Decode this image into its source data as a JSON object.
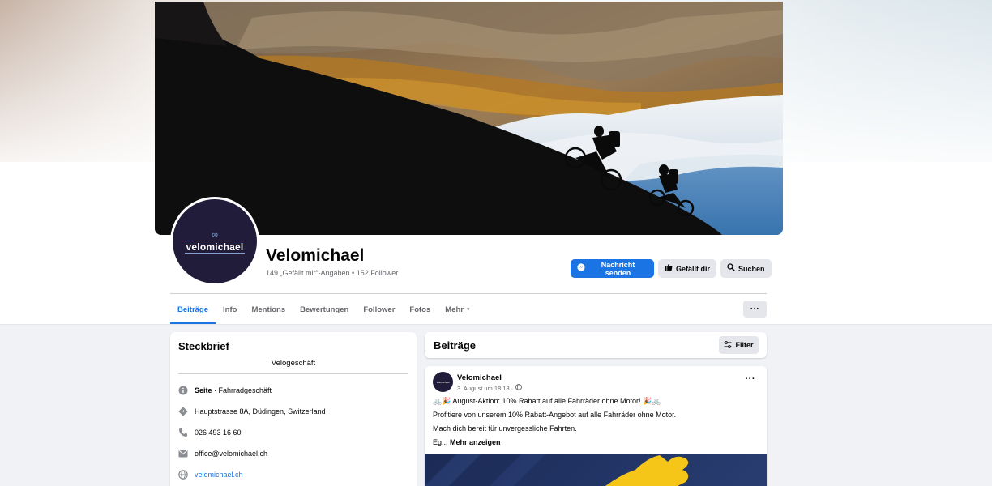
{
  "page": {
    "name": "Velomichael",
    "stats": "149 „Gefällt mir“-Angaben • 152 Follower",
    "avatar_text": "velomichael"
  },
  "actions": {
    "message": "Nachricht senden",
    "like": "Gefällt dir",
    "search": "Suchen",
    "more": "···"
  },
  "tabs": [
    {
      "label": "Beiträge",
      "active": true
    },
    {
      "label": "Info"
    },
    {
      "label": "Mentions"
    },
    {
      "label": "Bewertungen"
    },
    {
      "label": "Follower"
    },
    {
      "label": "Fotos"
    },
    {
      "label": "Mehr",
      "caret": "▾"
    }
  ],
  "intro": {
    "title": "Steckbrief",
    "category": "Velogeschäft",
    "page_type_bold": "Seite",
    "page_type_rest": " · Fahrradgeschäft",
    "address": "Hauptstrasse 8A, Düdingen, Switzerland",
    "phone": "026 493 16 60",
    "email": "office@velomichael.ch",
    "website": "velomichael.ch"
  },
  "posts": {
    "title": "Beiträge",
    "filter": "Filter"
  },
  "post": {
    "avatar_text": "velomichael",
    "author": "Velomichael",
    "date": "3. August um 18:18 ·",
    "line1": "🚲🎉 August-Aktion: 10% Rabatt auf alle Fahrräder ohne Motor! 🎉🚲",
    "line2": "Profitiere von unserem 10% Rabatt-Angebot auf alle Fahrräder ohne Motor.",
    "line3": "Mach dich bereit für unvergessliche Fahrten.",
    "line4_prefix": "Eg... ",
    "line4_more": "Mehr anzeigen",
    "dots": "···"
  },
  "colors": {
    "accent": "#1b74e4",
    "brand_dark": "#201c3a"
  }
}
